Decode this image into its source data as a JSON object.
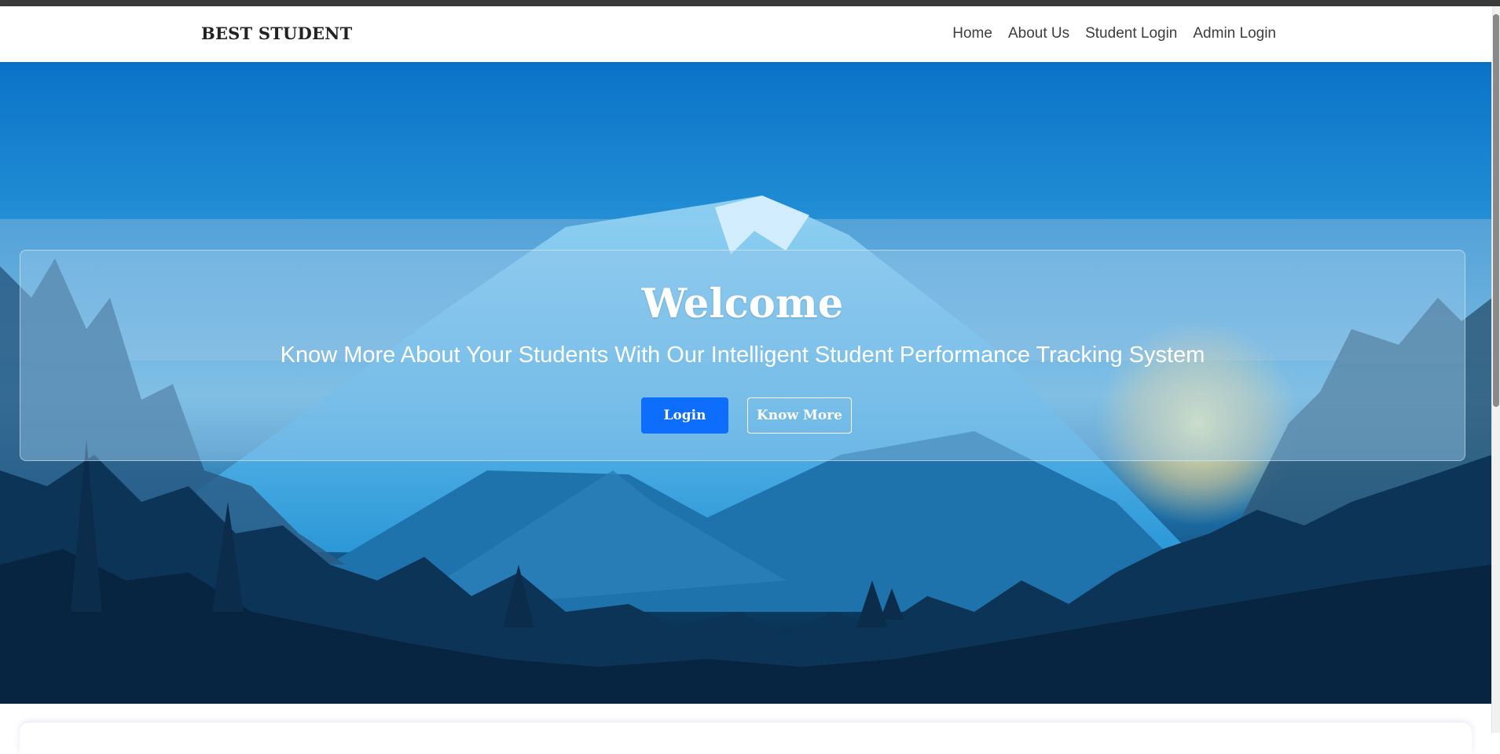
{
  "navbar": {
    "brand": "BEST STUDENT",
    "links": [
      {
        "label": "Home"
      },
      {
        "label": "About Us"
      },
      {
        "label": "Student Login"
      },
      {
        "label": "Admin Login"
      }
    ]
  },
  "hero": {
    "title": "Welcome",
    "tagline": "Know More About Your Students With Our Intelligent Student Performance Tracking System",
    "login_label": "Login",
    "know_more_label": "Know More"
  },
  "colors": {
    "primary_button": "#0d6efd",
    "hero_sky": "#0a73c7",
    "hero_dark": "#041e36"
  },
  "icons": {
    "background": "mountain-landscape-illustration"
  }
}
